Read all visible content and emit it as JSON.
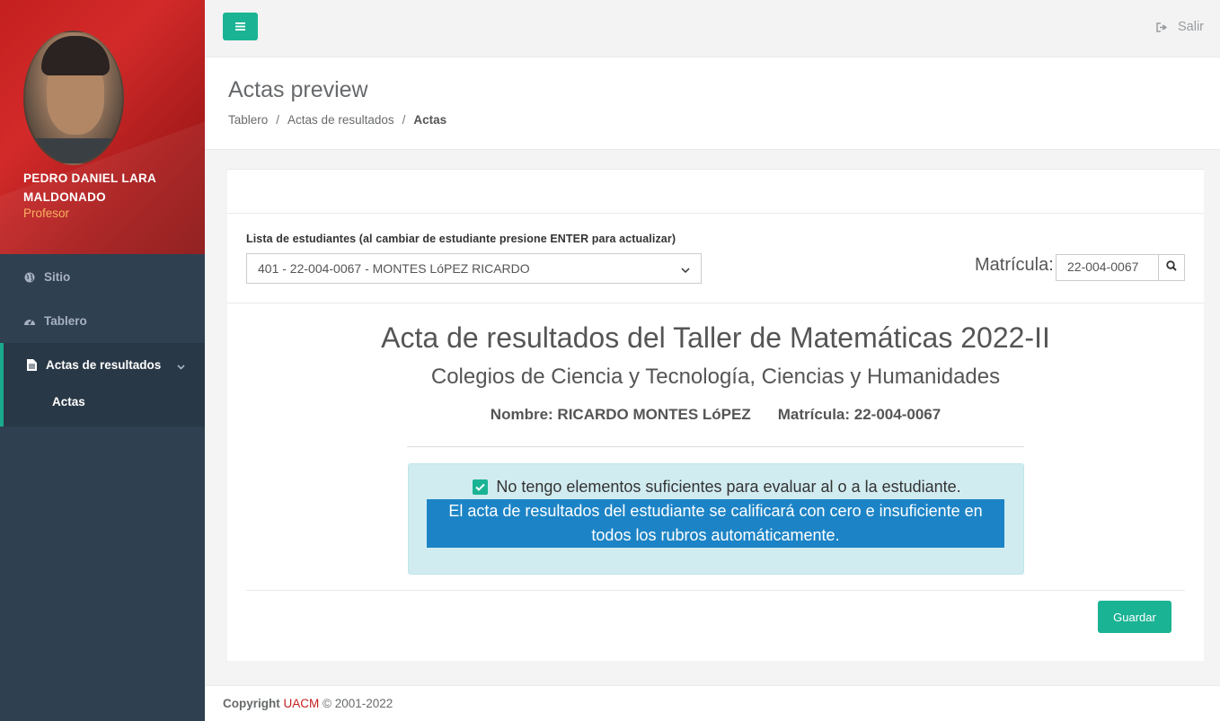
{
  "sidebar": {
    "user_name": "PEDRO DANIEL LARA MALDONADO",
    "user_role": "Profesor",
    "items": [
      {
        "label": "Sitio",
        "icon": "globe-icon"
      },
      {
        "label": "Tablero",
        "icon": "dashboard-icon"
      },
      {
        "label": "Actas de resultados",
        "icon": "file-icon"
      }
    ],
    "sub_items": [
      {
        "label": "Actas"
      }
    ]
  },
  "topbar": {
    "logout_label": "Salir"
  },
  "page": {
    "title": "Actas preview",
    "breadcrumb": [
      "Tablero",
      "Actas de resultados",
      "Actas"
    ]
  },
  "form": {
    "list_label": "Lista de estudiantes (al cambiar de estudiante presione ENTER para actualizar)",
    "selected_student": "401 - 22-004-0067 - MONTES LóPEZ RICARDO",
    "matricula_label": "Matrícula:",
    "matricula_value": "22-004-0067"
  },
  "acta": {
    "title": "Acta de resultados del Taller de Matemáticas 2022-II",
    "subtitle": "Colegios de Ciencia y Tecnología, Ciencias y Humanidades",
    "nombre": "Nombre: RICARDO MONTES LóPEZ",
    "matricula": "Matrícula: 22-004-0067",
    "checkbox_label": "No tengo elementos suficientes para evaluar al o a la estudiante.",
    "checkbox_checked": true,
    "warning": "El acta de resultados del estudiante se calificará con cero e insuficiente en todos los rubros automáticamente.",
    "save_label": "Guardar"
  },
  "footer": {
    "copyright": "Copyright",
    "brand": "UACM",
    "years": "© 2001-2022"
  },
  "colors": {
    "accent": "#1ab394",
    "sidebar": "#2f4050",
    "profile_bg": "#c4201f",
    "warning_bg": "#1c84c6",
    "alert_bg": "#d1ecf1"
  }
}
